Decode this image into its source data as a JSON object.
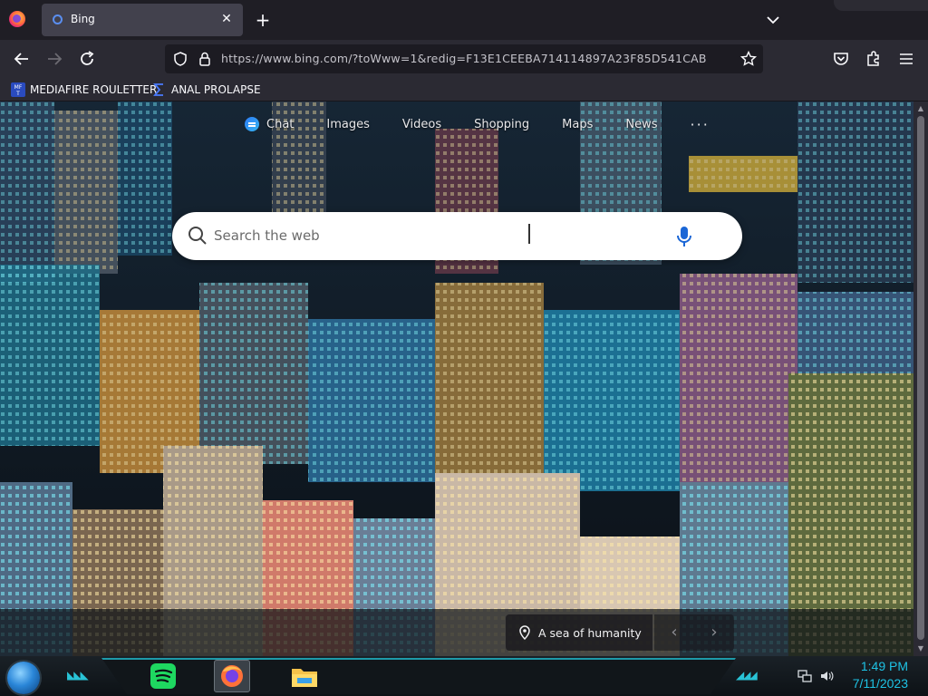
{
  "browser": {
    "tab": {
      "title": "Bing",
      "close": "✕"
    },
    "new_tab": "+",
    "url": "https://www.bing.com/?toWww=1&redig=F13E1CEEBA714114897A23F85D541CAB",
    "bookmarks": [
      {
        "label": "MEDIAFIRE ROULETTER"
      },
      {
        "label": "ANAL PROLAPSE"
      }
    ]
  },
  "bing": {
    "nav": {
      "chat": "Chat",
      "images": "Images",
      "videos": "Videos",
      "shopping": "Shopping",
      "maps": "Maps",
      "news": "News",
      "more": "···"
    },
    "search": {
      "placeholder": "Search the web",
      "value": ""
    },
    "caption": "A sea of humanity",
    "prev": "‹",
    "next": "›"
  },
  "taskbar": {
    "time": "1:49 PM",
    "date": "7/11/2023"
  },
  "colors": {
    "accent_teal": "#1ec2e4",
    "tab_bg": "#42414d",
    "toolbar_bg": "#2b2a33"
  }
}
